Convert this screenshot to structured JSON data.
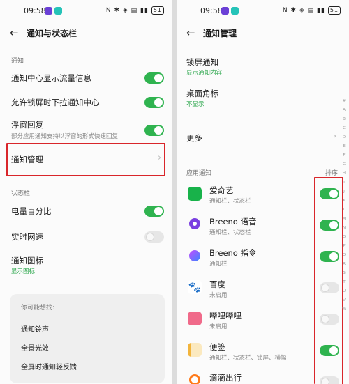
{
  "status": {
    "time": "09:58",
    "system": "N ✱ ◈ ▤ ▮▮",
    "battery": "51"
  },
  "left": {
    "title": "通知与状态栏",
    "section_notify": "通知",
    "rows": [
      {
        "label": "通知中心显示流量信息",
        "toggle": "on"
      },
      {
        "label": "允许锁屏时下拉通知中心",
        "toggle": "on"
      },
      {
        "label": "浮窗回复",
        "sub": "部分应用通知支持以浮窗的形式快速回复",
        "toggle": "on"
      },
      {
        "label": "通知管理"
      }
    ],
    "section_status": "状态栏",
    "status_rows": [
      {
        "label": "电量百分比",
        "toggle": "on"
      },
      {
        "label": "实时网速",
        "toggle": "off"
      },
      {
        "label": "通知图标",
        "sub": "显示图标"
      }
    ],
    "suggest": {
      "head": "你可能想找:",
      "items": [
        "通知铃声",
        "全景光效",
        "全屏时通知轻反馈"
      ]
    }
  },
  "right": {
    "title": "通知管理",
    "lock": {
      "label": "锁屏通知",
      "sub": "显示通知内容"
    },
    "badge": {
      "label": "桌面角标",
      "sub": "不显示"
    },
    "more": "更多",
    "section": "应用通知",
    "sort": "排序",
    "apps": [
      {
        "name": "爱奇艺",
        "sub": "通知栏、状态栏",
        "toggle": "on",
        "icon": "iqiyi-icon",
        "color": "#18b24a"
      },
      {
        "name": "Breeno 语音",
        "sub": "通知栏、状态栏",
        "toggle": "on",
        "icon": "breeno-voice-icon",
        "color": "#7a3fe0"
      },
      {
        "name": "Breeno 指令",
        "sub": "通知栏",
        "toggle": "on",
        "icon": "breeno-command-icon",
        "color": "#4e7bff"
      },
      {
        "name": "百度",
        "sub": "未启用",
        "toggle": "off",
        "icon": "baidu-paw-icon",
        "color": "#2f6fe6"
      },
      {
        "name": "哔哩哔哩",
        "sub": "未启用",
        "toggle": "off",
        "icon": "bilibili-icon",
        "color": "#f06a8a"
      },
      {
        "name": "便签",
        "sub": "通知栏、状态栏、锁屏、横幅",
        "toggle": "on",
        "icon": "notes-icon",
        "color": "#f2b43c"
      },
      {
        "name": "滴滴出行",
        "sub": "",
        "toggle": "off",
        "icon": "didi-icon",
        "color": "#ff7a1a"
      }
    ],
    "alphabet": [
      "#",
      "A",
      "B",
      "C",
      "D",
      "E",
      "F",
      "G",
      "H",
      "I",
      "J",
      "K",
      "L",
      "M",
      "N",
      "O",
      "P",
      "Q",
      "R",
      "S",
      "T",
      "U",
      "V",
      "W"
    ]
  }
}
